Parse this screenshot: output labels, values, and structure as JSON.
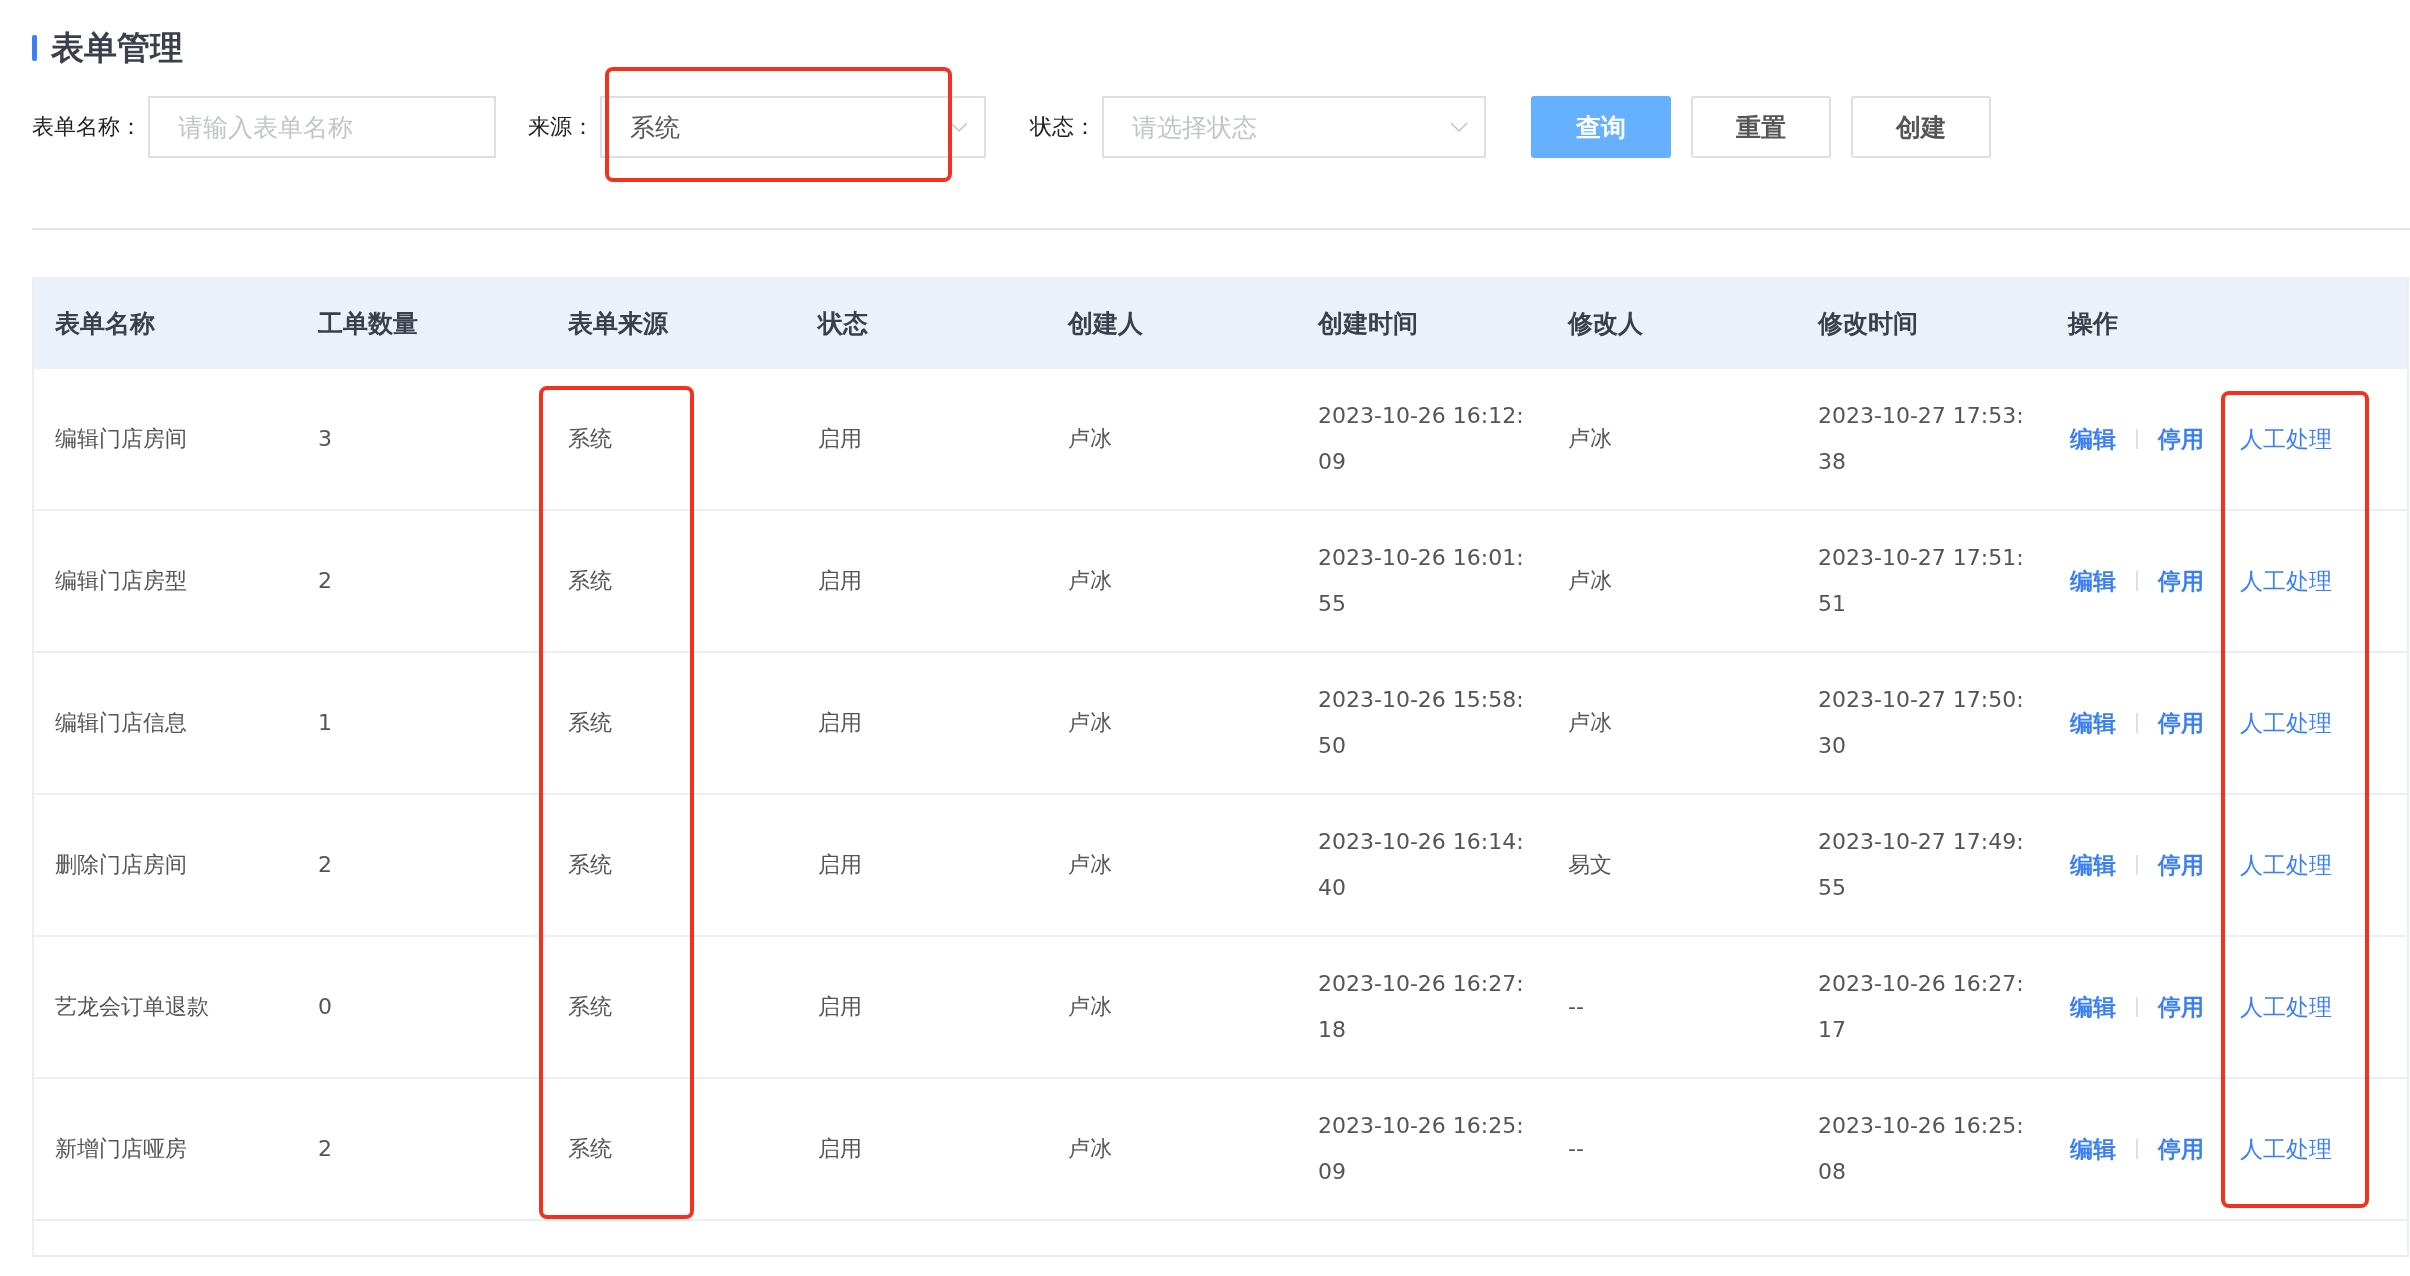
{
  "page_title": "表单管理",
  "filters": [
    {
      "kind": "input",
      "label": "表单名称：",
      "placeholder": "请输入表单名称"
    },
    {
      "kind": "select",
      "label": "来源：",
      "value": "系统"
    },
    {
      "kind": "select",
      "label": "状态：",
      "placeholder": "请选择状态"
    }
  ],
  "buttons": [
    {
      "label": "查询",
      "kind": "primary"
    },
    {
      "label": "重置",
      "kind": "plain"
    },
    {
      "label": "创建",
      "kind": "plain"
    }
  ],
  "table": {
    "columns": [
      "表单名称",
      "工单数量",
      "表单来源",
      "状态",
      "创建人",
      "创建时间",
      "修改人",
      "修改时间",
      "操作"
    ],
    "rows": [
      {
        "cells": [
          "编辑门店房间",
          "3",
          "系统",
          "启用",
          "卢冰",
          "2023-10-26 16:12:09",
          "卢冰",
          "2023-10-27 17:53:38"
        ],
        "actions": [
          "编辑",
          "停用",
          "人工处理"
        ]
      },
      {
        "cells": [
          "编辑门店房型",
          "2",
          "系统",
          "启用",
          "卢冰",
          "2023-10-26 16:01:55",
          "卢冰",
          "2023-10-27 17:51:51"
        ],
        "actions": [
          "编辑",
          "停用",
          "人工处理"
        ]
      },
      {
        "cells": [
          "编辑门店信息",
          "1",
          "系统",
          "启用",
          "卢冰",
          "2023-10-26 15:58:50",
          "卢冰",
          "2023-10-27 17:50:30"
        ],
        "actions": [
          "编辑",
          "停用",
          "人工处理"
        ]
      },
      {
        "cells": [
          "删除门店房间",
          "2",
          "系统",
          "启用",
          "卢冰",
          "2023-10-26 16:14:40",
          "易文",
          "2023-10-27 17:49:55"
        ],
        "actions": [
          "编辑",
          "停用",
          "人工处理"
        ]
      },
      {
        "cells": [
          "艺龙会订单退款",
          "0",
          "系统",
          "启用",
          "卢冰",
          "2023-10-26 16:27:18",
          "--",
          "2023-10-26 16:27:17"
        ],
        "actions": [
          "编辑",
          "停用",
          "人工处理"
        ]
      },
      {
        "cells": [
          "新增门店哑房",
          "2",
          "系统",
          "启用",
          "卢冰",
          "2023-10-26 16:25:09",
          "--",
          "2023-10-26 16:25:08"
        ],
        "actions": [
          "编辑",
          "停用",
          "人工处理"
        ]
      }
    ]
  },
  "highlights": [
    {
      "kind": "filter"
    },
    {
      "kind": "column"
    },
    {
      "kind": "action"
    }
  ]
}
